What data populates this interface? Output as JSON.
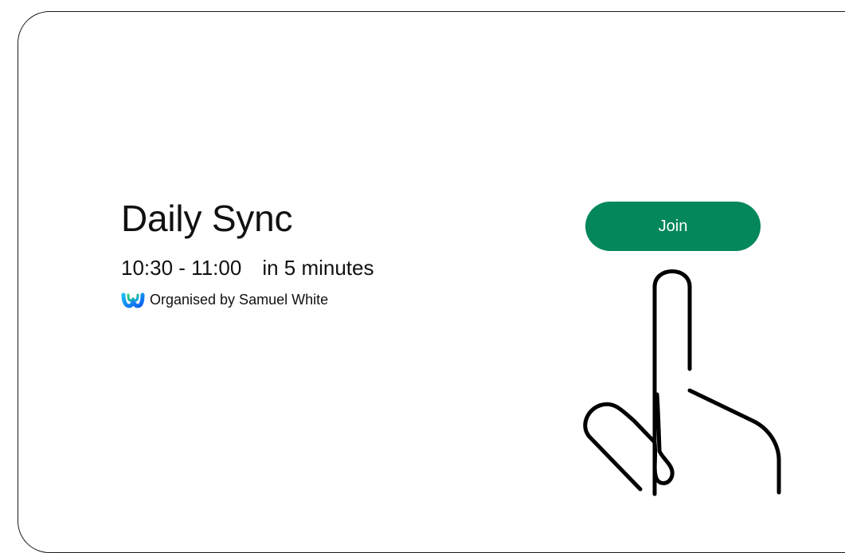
{
  "meeting": {
    "title": "Daily Sync",
    "time_range": "10:30 - 11:00",
    "starts_in": "in 5 minutes",
    "organizer_text": "Organised by Samuel White",
    "organizer_icon": "webex-icon"
  },
  "join": {
    "label": "Join",
    "color": "#04875a"
  },
  "illustration": {
    "icon": "hand-pointer-icon"
  }
}
